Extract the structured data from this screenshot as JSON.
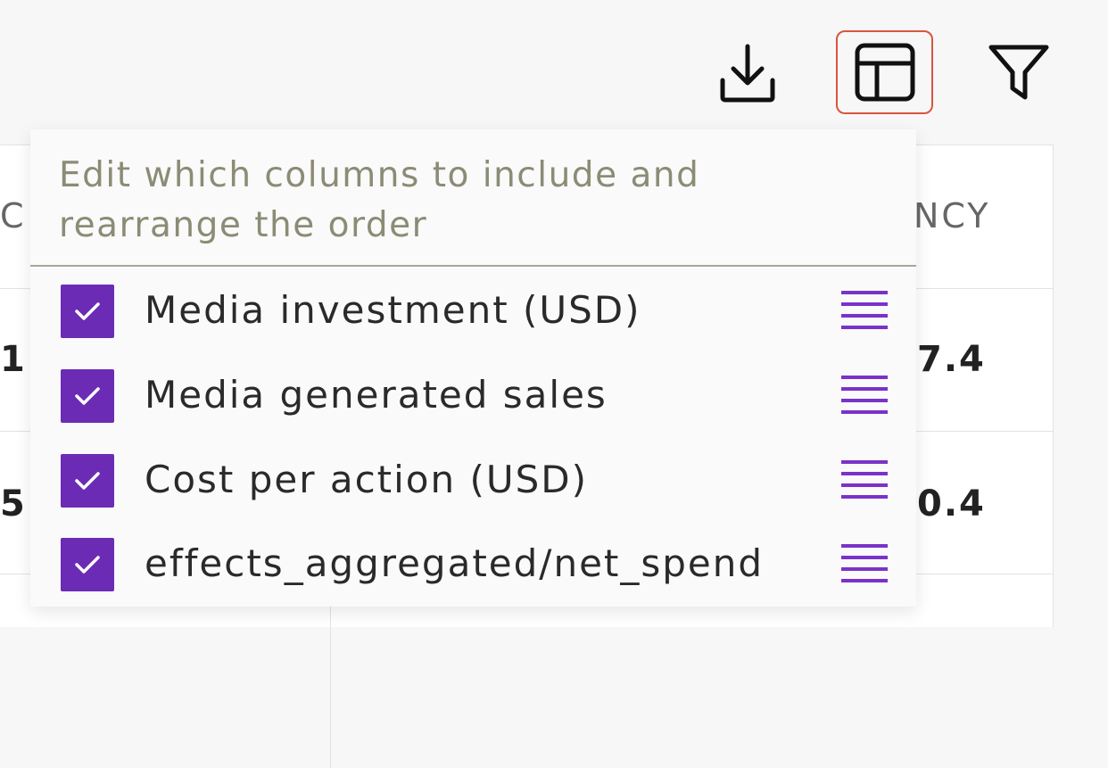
{
  "toolbar": {
    "download_icon": "download-icon",
    "columns_icon": "table-columns-icon",
    "filter_icon": "filter-icon"
  },
  "background_table": {
    "header_fragments": [
      "C",
      "NCY"
    ],
    "row1_fragments": [
      "1",
      "7.4"
    ],
    "row2_fragments": [
      "5",
      "0.4"
    ]
  },
  "column_editor": {
    "instructions": "Edit which columns to include and rearrange the order",
    "columns": [
      {
        "label": "Media investment (USD)",
        "checked": true
      },
      {
        "label": "Media generated sales",
        "checked": true
      },
      {
        "label": "Cost per action (USD)",
        "checked": true
      },
      {
        "label": "effects_aggregated/net_spend",
        "checked": true
      }
    ]
  },
  "colors": {
    "accent_purple": "#6b2bb5",
    "active_outline": "#d9553f",
    "instruction_text": "#8c8c76"
  }
}
